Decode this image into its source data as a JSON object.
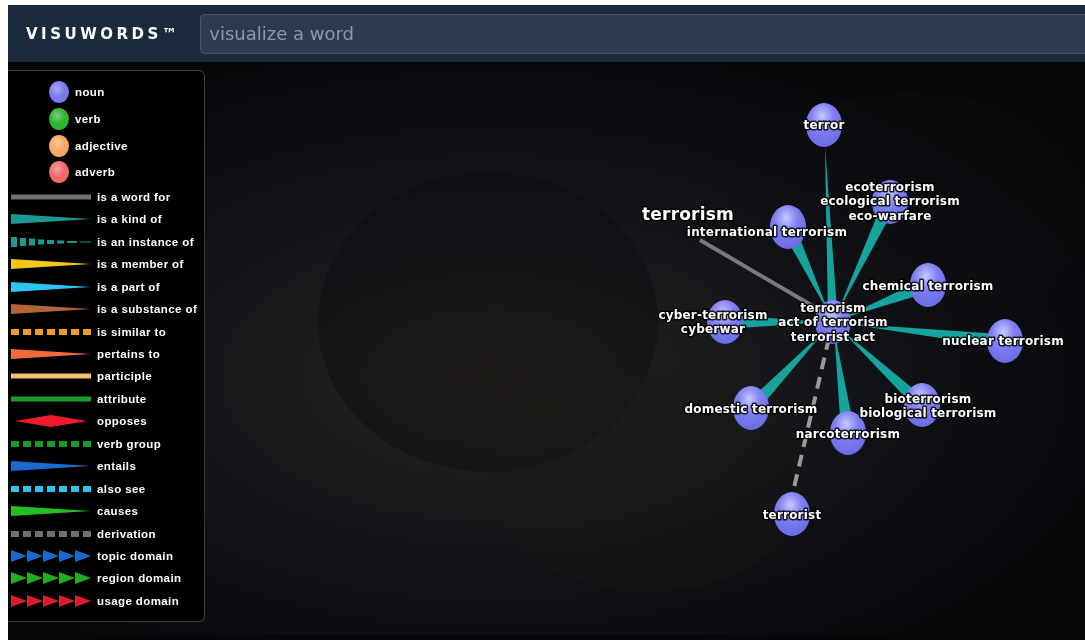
{
  "header": {
    "logo": "VISUWORDS™",
    "search": {
      "placeholder": "visualize a word"
    }
  },
  "legend": {
    "parts_of_speech": [
      {
        "label": "noun",
        "color": "#7b7bef"
      },
      {
        "label": "verb",
        "color": "#2db52d"
      },
      {
        "label": "adjective",
        "color": "#f5a860"
      },
      {
        "label": "adverb",
        "color": "#ef6b6b"
      }
    ],
    "relations": [
      {
        "label": "is a word for",
        "kind": "solid",
        "color": "#707070"
      },
      {
        "label": "is a kind of",
        "kind": "taper",
        "color": "#1a9a94"
      },
      {
        "label": "is an instance of",
        "kind": "fading",
        "color": "#1a9a94"
      },
      {
        "label": "is a member of",
        "kind": "taper",
        "color": "#f5c518"
      },
      {
        "label": "is a part of",
        "kind": "taper",
        "color": "#2ec4f0"
      },
      {
        "label": "is a substance of",
        "kind": "taper",
        "color": "#b0643a"
      },
      {
        "label": "is similar to",
        "kind": "dashed",
        "color": "#f0a020"
      },
      {
        "label": "pertains to",
        "kind": "taper",
        "color": "#f26a3a"
      },
      {
        "label": "participle",
        "kind": "solid",
        "color": "#f5c070"
      },
      {
        "label": "attribute",
        "kind": "solid",
        "color": "#1a9a2a"
      },
      {
        "label": "opposes",
        "kind": "diamond",
        "color": "#f01a2a"
      },
      {
        "label": "verb group",
        "kind": "dashed",
        "color": "#1a9a2a"
      },
      {
        "label": "entails",
        "kind": "taper",
        "color": "#1a6ad0"
      },
      {
        "label": "also see",
        "kind": "dashed",
        "color": "#2ec4f0"
      },
      {
        "label": "causes",
        "kind": "taper",
        "color": "#22c022"
      },
      {
        "label": "derivation",
        "kind": "dashed",
        "color": "#707070"
      },
      {
        "label": "topic domain",
        "kind": "arrows",
        "color": "#1a6ad0"
      },
      {
        "label": "region domain",
        "kind": "arrows",
        "color": "#22b022"
      },
      {
        "label": "usage domain",
        "kind": "arrows",
        "color": "#e01a2a"
      }
    ]
  },
  "graph": {
    "word": {
      "label": "terrorism",
      "kind": "synonym"
    },
    "center": {
      "labels": [
        "terrorism",
        "act of terrorism",
        "terrorist act"
      ]
    },
    "nodes": [
      {
        "labels": [
          "terror"
        ],
        "kind": "hypernym"
      },
      {
        "labels": [
          "ecoterrorism",
          "ecological terrorism",
          "eco-warfare"
        ],
        "kind": "hyponym"
      },
      {
        "labels": [
          "international terrorism"
        ],
        "kind": "hyponym"
      },
      {
        "labels": [
          "chemical terrorism"
        ],
        "kind": "hyponym"
      },
      {
        "labels": [
          "cyber-terrorism",
          "cyberwar"
        ],
        "kind": "hyponym"
      },
      {
        "labels": [
          "nuclear terrorism"
        ],
        "kind": "hyponym"
      },
      {
        "labels": [
          "domestic terrorism"
        ],
        "kind": "hyponym"
      },
      {
        "labels": [
          "bioterrorism",
          "biological terrorism"
        ],
        "kind": "hyponym"
      },
      {
        "labels": [
          "narcoterrorism"
        ],
        "kind": "hyponym"
      },
      {
        "labels": [
          "terrorist"
        ],
        "kind": "derivation"
      }
    ]
  }
}
